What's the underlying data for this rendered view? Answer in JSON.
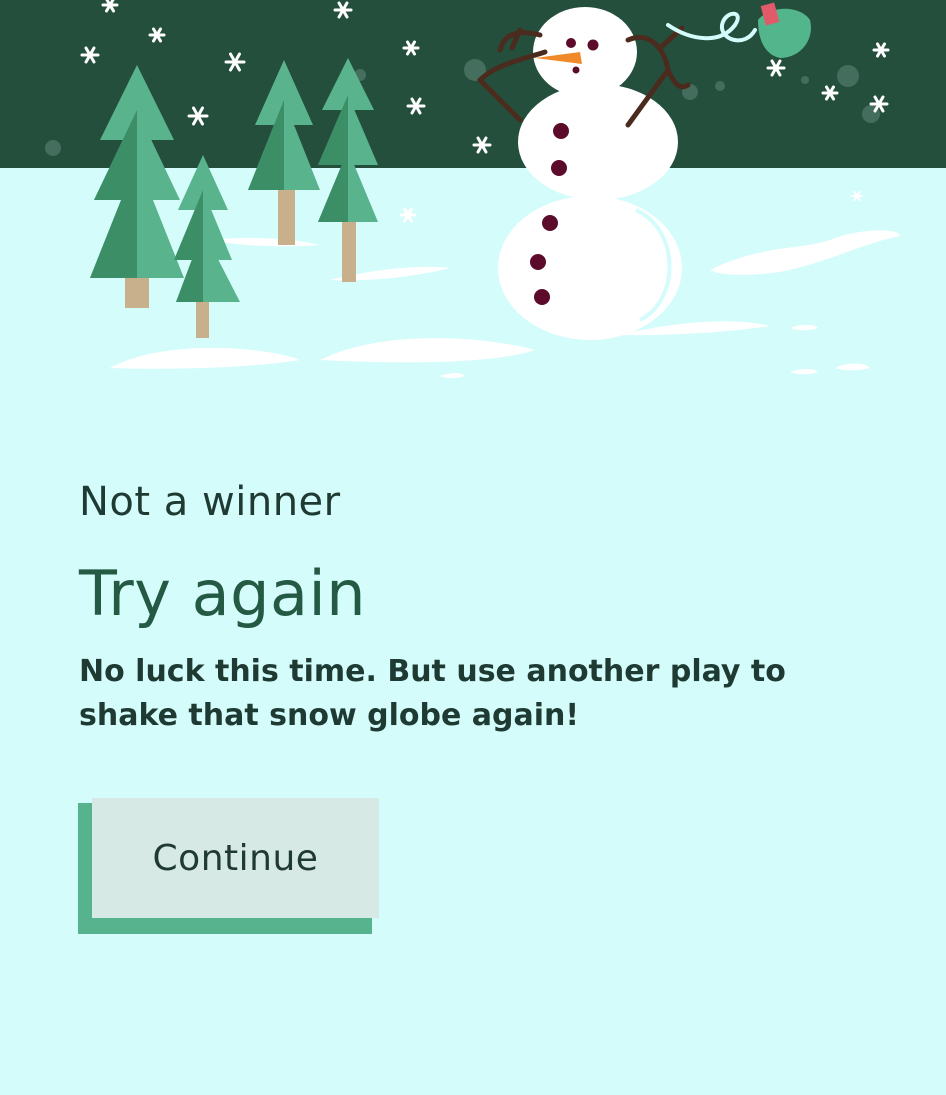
{
  "result": {
    "eyebrow": "Not a winner",
    "headline": "Try again",
    "message": "No luck this time. But use another play to shake that snow globe again!"
  },
  "actions": {
    "continue_label": "Continue"
  },
  "illustration": {
    "sky_color": "#244f3d",
    "snow_color": "#d4fcfb",
    "tree_light": "#59b48d",
    "tree_dark": "#3c8e66",
    "trunk_color": "#c8b08c",
    "snowman_color": "#ffffff",
    "button_dot_color": "#5c0b2a",
    "nose_color": "#f08a28",
    "arm_color": "#4a2b1e",
    "accent_bird_color": "#53b58c",
    "accent_red": "#e05a6a"
  },
  "theme": {
    "background": "#d4fcfb",
    "headline_color": "#245a44",
    "text_color": "#1f3a32",
    "button_fill": "#d6e9e4",
    "button_shadow": "#57b38d"
  }
}
